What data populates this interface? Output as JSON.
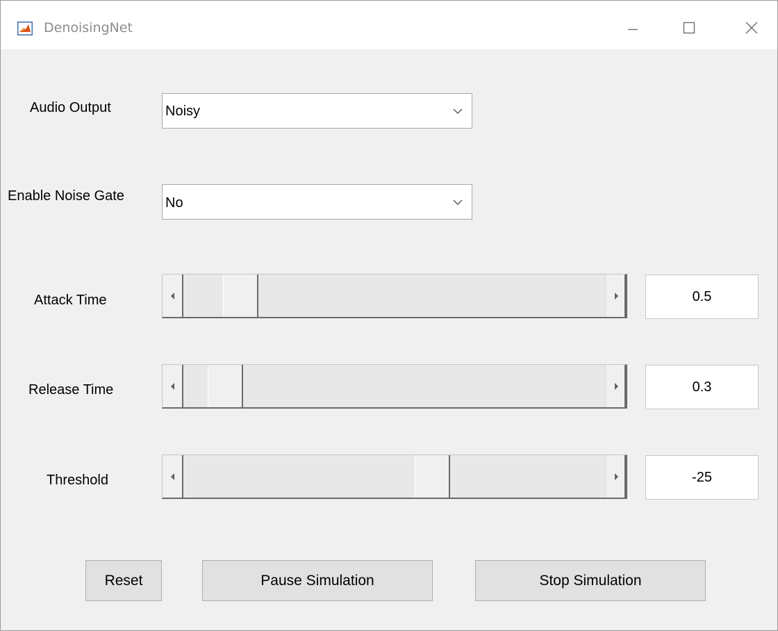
{
  "window": {
    "title": "DenoisingNet",
    "app_icon": "matlab-logo-icon",
    "controls": {
      "minimize_icon": "minimize-icon",
      "maximize_icon": "maximize-icon",
      "close_icon": "close-icon"
    }
  },
  "audio_output": {
    "label": "Audio Output",
    "selected": "Noisy",
    "arrow_icon": "chevron-down-icon"
  },
  "noise_gate": {
    "label": "Enable Noise Gate",
    "selected": "No",
    "arrow_icon": "chevron-down-icon"
  },
  "attack_time": {
    "label": "Attack Time",
    "value": "0.5",
    "slider_fraction": 0.1
  },
  "release_time": {
    "label": "Release Time",
    "value": "0.3",
    "slider_fraction": 0.06
  },
  "threshold": {
    "label": "Threshold",
    "value": "-25",
    "slider_fraction": 0.6
  },
  "buttons": {
    "reset": "Reset",
    "pause": "Pause Simulation",
    "stop": "Stop Simulation"
  },
  "colors": {
    "window_background": "#f0f0f0",
    "button_face": "#e1e1e1",
    "titlebar": "#ffffff"
  }
}
